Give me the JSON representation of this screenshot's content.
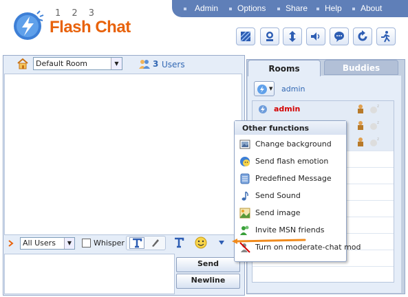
{
  "brand": {
    "digits": "1 2 3",
    "name": "Flash Chat",
    "accent": "#e8620b"
  },
  "nav": {
    "items": [
      "Admin",
      "Options",
      "Share",
      "Help",
      "About"
    ]
  },
  "toolbar": {
    "icons": [
      "skin-icon",
      "avatar-icon",
      "resize-icon",
      "volume-icon",
      "status-icon",
      "refresh-icon",
      "logout-icon"
    ]
  },
  "room": {
    "selected": "Default Room",
    "user_count": "3",
    "users_label": "Users"
  },
  "input": {
    "recipient": "All Users",
    "whisper_label": "Whisper"
  },
  "buttons": {
    "send": "Send",
    "newline": "Newline"
  },
  "panel": {
    "tabs": [
      "Rooms",
      "Buddies"
    ],
    "current_user": "admin",
    "users": [
      {
        "name": "admin",
        "highlight": true
      },
      {
        "name": "",
        "highlight": false
      },
      {
        "name": "",
        "highlight": false
      }
    ]
  },
  "menu": {
    "title": "Other functions",
    "items": [
      {
        "label": "Change background",
        "icon": "background-icon"
      },
      {
        "label": "Send flash emotion",
        "icon": "emotion-icon"
      },
      {
        "label": "Predefined Message",
        "icon": "message-icon"
      },
      {
        "label": "Send Sound",
        "icon": "sound-icon"
      },
      {
        "label": "Send image",
        "icon": "image-icon"
      },
      {
        "label": "Invite MSN friends",
        "icon": "msn-icon"
      },
      {
        "label": "Turn on moderate-chat mod",
        "icon": "moderate-icon"
      }
    ]
  }
}
